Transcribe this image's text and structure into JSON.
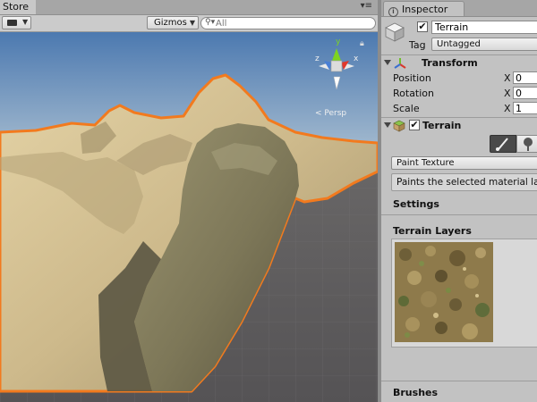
{
  "scene": {
    "tab_label": "Store",
    "menu_glyph": "▾≡",
    "toolbar": {
      "gizmos_label": "Gizmos",
      "search_placeholder": "All"
    },
    "gizmo": {
      "y_axis": "y",
      "x_axis": "x",
      "z_axis": "z",
      "persp_label": "< Persp"
    },
    "colors": {
      "sky_top": "#4c79b0",
      "sky_bottom": "#c9d7e2",
      "ground": "#5c5a5c",
      "sand": "#cdb98b",
      "rock": "#7d7758",
      "selection_outline": "#f27a1e"
    }
  },
  "inspector": {
    "tab_label": "Inspector",
    "gameobject": {
      "active": true,
      "name": "Terrain",
      "tag_label": "Tag",
      "tag_value": "Untagged"
    },
    "transform": {
      "title": "Transform",
      "position_label": "Position",
      "rotation_label": "Rotation",
      "scale_label": "Scale",
      "axis_label": "X",
      "position_x": "0",
      "rotation_x": "0",
      "scale_x": "1"
    },
    "terrain": {
      "title": "Terrain",
      "enabled": true,
      "paint_mode": "Paint Texture",
      "help_text": "Paints the selected material layer onto the terrain texture.",
      "settings_label": "Settings",
      "layers_label": "Terrain Layers",
      "brushes_label": "Brushes"
    }
  }
}
